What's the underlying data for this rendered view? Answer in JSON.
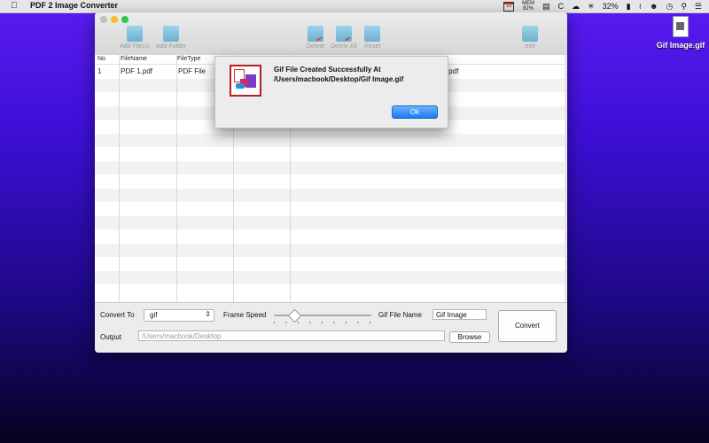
{
  "menubar": {
    "app_name": "PDF 2 Image Converter",
    "calendar_day": "23",
    "mem_label": "MEM",
    "mem_value": "82%",
    "c_label": "C",
    "battery": "32%"
  },
  "desktop": {
    "file_label": "Gif Image.gif"
  },
  "toolbar": {
    "add_files": "Add File(s)",
    "add_folder": "Add Folder",
    "delete": "Delete",
    "delete_all": "Delete All",
    "reset": "Reset",
    "exit": "exit"
  },
  "table": {
    "headers": {
      "no": "No",
      "filename": "FileName",
      "filetype": "FileType"
    },
    "rows": [
      {
        "no": "1",
        "filename": "PDF 1.pdf",
        "filetype": "PDF File",
        "path": ".pdf"
      }
    ]
  },
  "bottom": {
    "convert_to_label": "Convert To",
    "format_value": "gif",
    "frame_speed_label": "Frame Speed",
    "gif_name_label": "Gif File Name",
    "gif_name_value": "Gif Image",
    "convert_button": "Convert",
    "output_label": "Output",
    "output_path": "/Users/macbook/Desktop",
    "browse_button": "Browse",
    "frame_speed_level": 0.18
  },
  "dialog": {
    "message": "Gif File Created Successfully At /Users/macbook/Desktop/Gif Image.gif",
    "ok_label": "Ok"
  },
  "colors": {
    "accent": "#1a7cf2",
    "desktop": "#4a14e6"
  }
}
